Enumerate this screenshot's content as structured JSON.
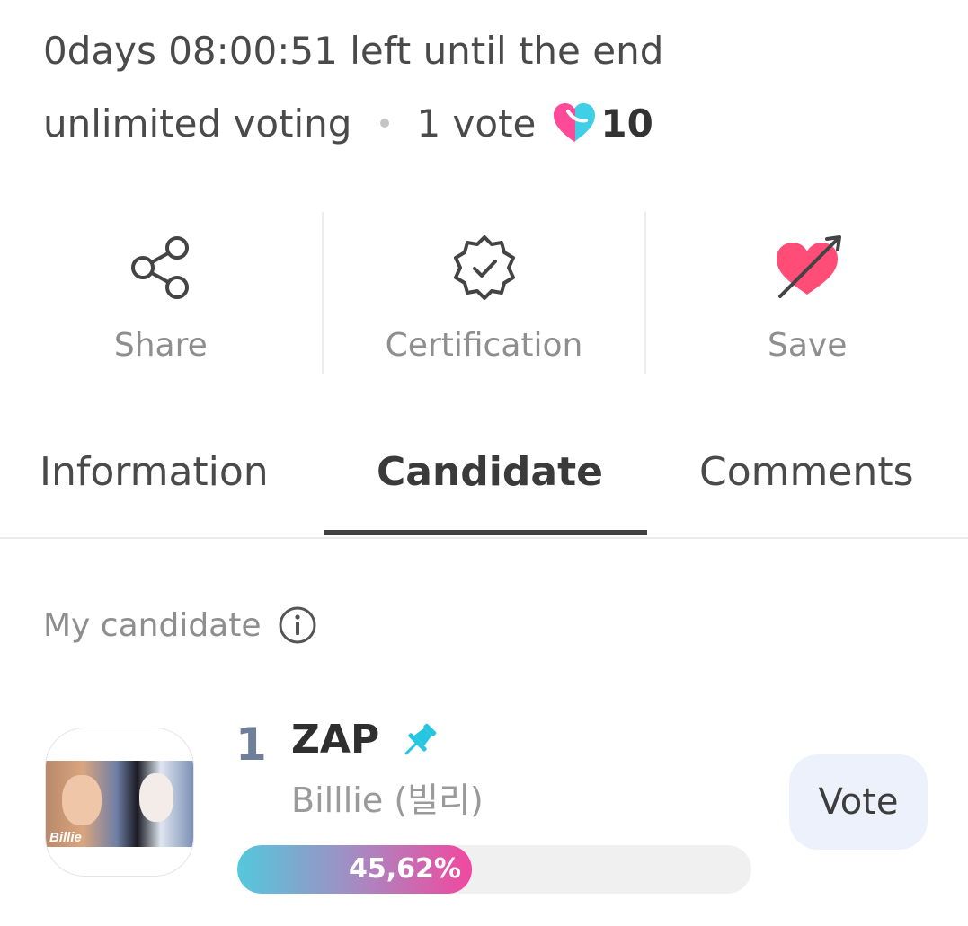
{
  "header": {
    "countdown": "0days 08:00:51 left until the end",
    "voting_mode": "unlimited voting",
    "vote_unit": "1 vote",
    "vote_cost": "10",
    "heart_icon": "heart-pink-cyan-icon"
  },
  "actions": [
    {
      "label": "Share",
      "icon": "share-icon"
    },
    {
      "label": "Certification",
      "icon": "verified-badge-icon"
    },
    {
      "label": "Save",
      "icon": "heart-arrow-icon"
    }
  ],
  "tabs": [
    {
      "label": "Information",
      "active": false
    },
    {
      "label": "Candidate",
      "active": true
    },
    {
      "label": "Comments",
      "active": false
    }
  ],
  "my_candidate": {
    "section_label": "My candidate",
    "rank": "1",
    "name": "ZAP",
    "group": "Billlie (빌리)",
    "thumbnail_caption": "Billie",
    "percent_text": "45,62%",
    "percent_value": 45.62,
    "vote_button": "Vote"
  },
  "colors": {
    "progress_start": "#53c8dc",
    "progress_end": "#f1489f",
    "heart_pink": "#ff4a86",
    "pin_cyan": "#27c6e0",
    "vote_button_bg": "#edf1fb"
  }
}
